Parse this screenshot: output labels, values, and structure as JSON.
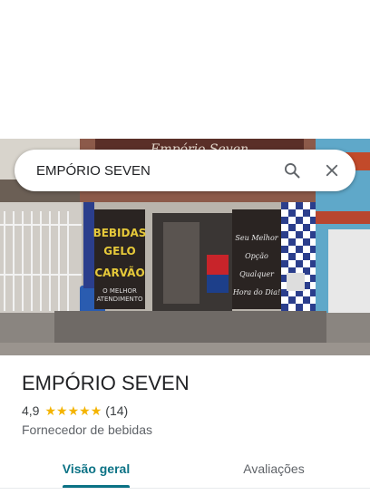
{
  "search": {
    "query": "EMPÓRIO SEVEN"
  },
  "place": {
    "name": "EMPÓRIO SEVEN",
    "rating": "4,9",
    "reviews_count": "(14)",
    "stars": 5,
    "category": "Fornecedor de bebidas"
  },
  "tabs": [
    {
      "label": "Visão geral",
      "active": true
    },
    {
      "label": "Avaliações",
      "active": false
    }
  ],
  "storefront": {
    "sign": "Empório Seven",
    "door_left_lines": [
      "BEBIDAS",
      "GELO",
      "CARVÃO",
      "O MELHOR",
      "ATENDIMENTO"
    ],
    "door_right_lines": [
      "Seu Melhor",
      "Opção",
      "Qualquer",
      "Hora do Dia!"
    ]
  },
  "colors": {
    "accent": "#0b7285",
    "star": "#f4b400",
    "text": "#202124"
  },
  "icons": {
    "search": "search-icon",
    "close": "close-icon",
    "star": "star-icon"
  }
}
